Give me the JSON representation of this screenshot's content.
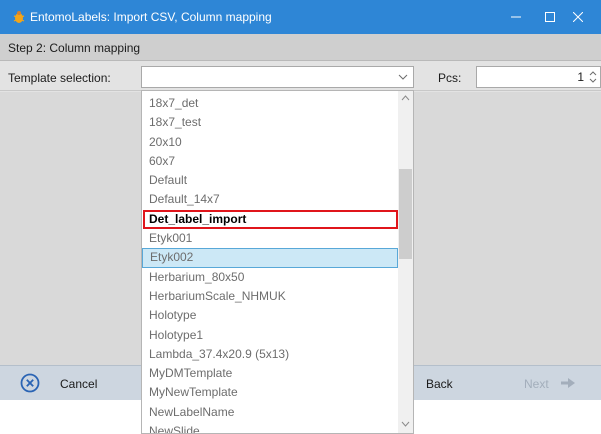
{
  "window": {
    "title": "EntomoLabels: Import CSV, Column mapping",
    "controls": [
      "minimize",
      "maximize",
      "close"
    ]
  },
  "step": {
    "title": "Step 2: Column mapping"
  },
  "form": {
    "template_label": "Template selection:",
    "template_value": "",
    "pcs_label": "Pcs:",
    "pcs_value": "1"
  },
  "dropdown": {
    "items": [
      {
        "label": "18x7_det"
      },
      {
        "label": "18x7_test"
      },
      {
        "label": "20x10"
      },
      {
        "label": "60x7"
      },
      {
        "label": "Default"
      },
      {
        "label": "Default_14x7"
      },
      {
        "label": "Det_label_import"
      },
      {
        "label": "Etyk001"
      },
      {
        "label": "Etyk002"
      },
      {
        "label": "Herbarium_80x50"
      },
      {
        "label": "HerbariumScale_NHMUK"
      },
      {
        "label": "Holotype"
      },
      {
        "label": "Holotype1"
      },
      {
        "label": "Lambda_37.4x20.9 (5x13)"
      },
      {
        "label": "MyDMTemplate"
      },
      {
        "label": "MyNewTemplate"
      },
      {
        "label": "NewLabelName"
      },
      {
        "label": "NewSlide"
      }
    ],
    "marked_item": "Det_label_import",
    "hovered_item": "Etyk002"
  },
  "buttons": {
    "cancel": "Cancel",
    "back": "Back",
    "next": "Next"
  },
  "colors": {
    "titlebar": "#2e86d6",
    "marker": "#e0151b",
    "hover": "#cce8f6",
    "cancel_icon": "#2a64b4"
  },
  "icons": {
    "app": "bug-icon",
    "cancel": "close-circle-icon",
    "next": "arrow-right-icon"
  }
}
